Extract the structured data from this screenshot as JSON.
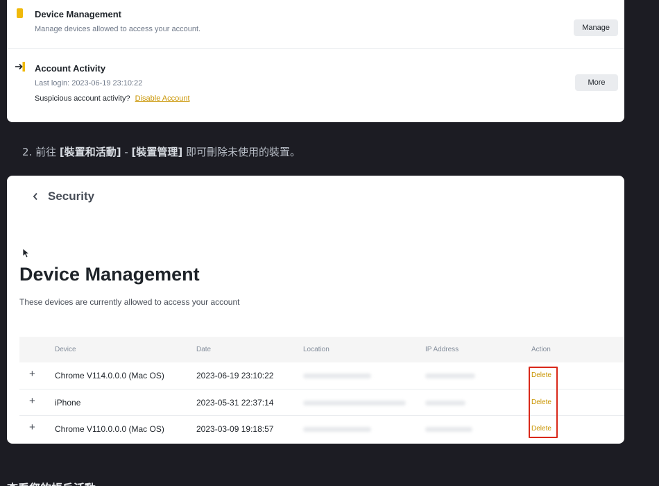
{
  "settings_card": {
    "device_management": {
      "title": "Device Management",
      "description": "Manage devices allowed to access your account.",
      "button_label": "Manage"
    },
    "account_activity": {
      "title": "Account Activity",
      "last_login": "Last login: 2023-06-19 23:10:22",
      "suspicious_text": "Suspicious account activity?",
      "disable_link": "Disable Account",
      "button_label": "More"
    }
  },
  "caption": {
    "prefix": "2. 前往 ",
    "bold1": "[裝置和活動]",
    "middle": " - ",
    "bold2": "[裝置管理]",
    "suffix": " 即可刪除未使用的裝置。"
  },
  "device_page": {
    "back_label": "Security",
    "title": "Device Management",
    "subtitle": "These devices are currently allowed to access your account",
    "columns": [
      "Device",
      "Date",
      "Location",
      "IP Address",
      "Action"
    ],
    "rows": [
      {
        "expand": "+",
        "device": "Chrome V114.0.0.0 (Mac OS)",
        "date": "2023-06-19 23:10:22",
        "action": "Delete"
      },
      {
        "expand": "+",
        "device": "iPhone",
        "date": "2023-05-31 22:37:14",
        "action": "Delete"
      },
      {
        "expand": "+",
        "device": "Chrome V110.0.0.0 (Mac OS)",
        "date": "2023-03-09 19:18:57",
        "action": "Delete"
      }
    ]
  },
  "footer_heading": "查看您的帳戶活動",
  "colors": {
    "accent": "#f0b90b",
    "link": "#c99400",
    "highlight": "#d9281a",
    "background": "#1c1c23"
  }
}
